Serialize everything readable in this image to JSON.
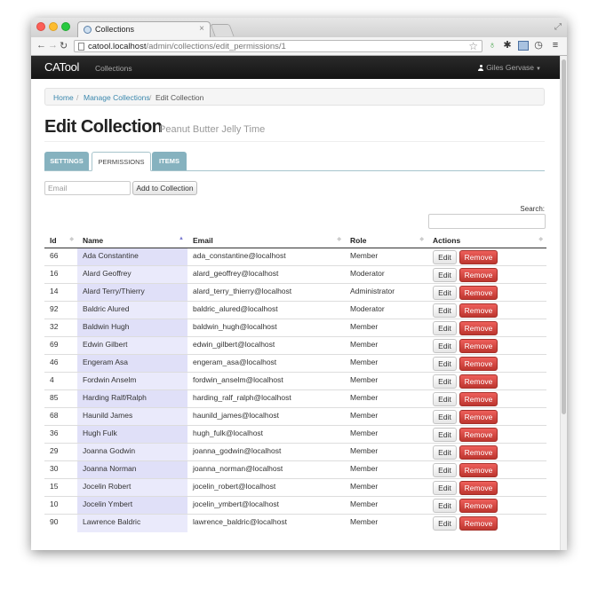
{
  "browser": {
    "tab_title": "Collections",
    "tab_close": "×",
    "url_host": "catool.localhost",
    "url_path": "/admin/collections/edit_permissions/1"
  },
  "navbar": {
    "brand": "CATool",
    "link": "Collections",
    "user": "Giles Gervase"
  },
  "breadcrumb": {
    "home": "Home",
    "sep": "/",
    "manage": "Manage Collections",
    "current": "Edit Collection"
  },
  "page": {
    "title": "Edit Collection",
    "subtitle": "Peanut Butter Jelly Time"
  },
  "tabs": {
    "settings": "SETTINGS",
    "permissions": "PERMISSIONS",
    "items": "ITEMS"
  },
  "add_form": {
    "email_placeholder": "Email",
    "button": "Add to Collection"
  },
  "search": {
    "label": "Search:"
  },
  "table": {
    "columns": [
      "Id",
      "Name",
      "Email",
      "Role",
      "Actions"
    ],
    "edit_label": "Edit",
    "remove_label": "Remove",
    "rows": [
      {
        "id": "66",
        "name": "Ada Constantine",
        "email": "ada_constantine@localhost",
        "role": "Member"
      },
      {
        "id": "16",
        "name": "Alard Geoffrey",
        "email": "alard_geoffrey@localhost",
        "role": "Moderator"
      },
      {
        "id": "14",
        "name": "Alard Terry/Thierry",
        "email": "alard_terry_thierry@localhost",
        "role": "Administrator"
      },
      {
        "id": "92",
        "name": "Baldric Alured",
        "email": "baldric_alured@localhost",
        "role": "Moderator"
      },
      {
        "id": "32",
        "name": "Baldwin Hugh",
        "email": "baldwin_hugh@localhost",
        "role": "Member"
      },
      {
        "id": "69",
        "name": "Edwin Gilbert",
        "email": "edwin_gilbert@localhost",
        "role": "Member"
      },
      {
        "id": "46",
        "name": "Engeram Asa",
        "email": "engeram_asa@localhost",
        "role": "Member"
      },
      {
        "id": "4",
        "name": "Fordwin Anselm",
        "email": "fordwin_anselm@localhost",
        "role": "Member"
      },
      {
        "id": "85",
        "name": "Harding Ralf/Ralph",
        "email": "harding_ralf_ralph@localhost",
        "role": "Member"
      },
      {
        "id": "68",
        "name": "Haunild James",
        "email": "haunild_james@localhost",
        "role": "Member"
      },
      {
        "id": "36",
        "name": "Hugh Fulk",
        "email": "hugh_fulk@localhost",
        "role": "Member"
      },
      {
        "id": "29",
        "name": "Joanna Godwin",
        "email": "joanna_godwin@localhost",
        "role": "Member"
      },
      {
        "id": "30",
        "name": "Joanna Norman",
        "email": "joanna_norman@localhost",
        "role": "Member"
      },
      {
        "id": "15",
        "name": "Jocelin Robert",
        "email": "jocelin_robert@localhost",
        "role": "Member"
      },
      {
        "id": "10",
        "name": "Jocelin Ymbert",
        "email": "jocelin_ymbert@localhost",
        "role": "Member"
      },
      {
        "id": "90",
        "name": "Lawrence Baldric",
        "email": "lawrence_baldric@localhost",
        "role": "Member"
      }
    ]
  }
}
